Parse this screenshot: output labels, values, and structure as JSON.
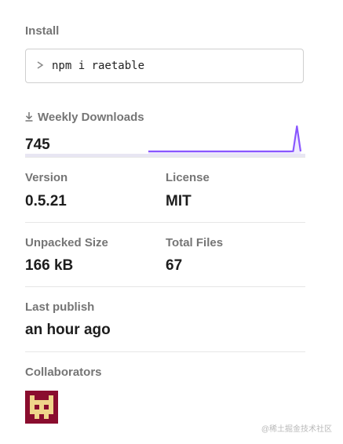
{
  "install": {
    "label": "Install",
    "command": "npm i raetable",
    "prompt_icon": "chevron-right-icon"
  },
  "downloads": {
    "label": "Weekly Downloads",
    "value": "745",
    "icon": "download-icon",
    "accent": "#8956ff",
    "sparkline": [
      0,
      0,
      0,
      0,
      0,
      0,
      0,
      0,
      0,
      0,
      0,
      0,
      0,
      0,
      0,
      0,
      0,
      0,
      0,
      0,
      0,
      0,
      0,
      0,
      0,
      0,
      0,
      0,
      0,
      0,
      0,
      0,
      0,
      0,
      0,
      0,
      0,
      0,
      1,
      5,
      745,
      0
    ]
  },
  "stats": {
    "version_label": "Version",
    "version_value": "0.5.21",
    "license_label": "License",
    "license_value": "MIT",
    "unpacked_label": "Unpacked Size",
    "unpacked_value": "166 kB",
    "files_label": "Total Files",
    "files_value": "67",
    "publish_label": "Last publish",
    "publish_value": "an hour ago"
  },
  "collaborators": {
    "label": "Collaborators",
    "avatar_bg": "#8a0d2e",
    "avatar_fg": "#efd48a"
  },
  "watermark": "@稀土掘金技术社区"
}
